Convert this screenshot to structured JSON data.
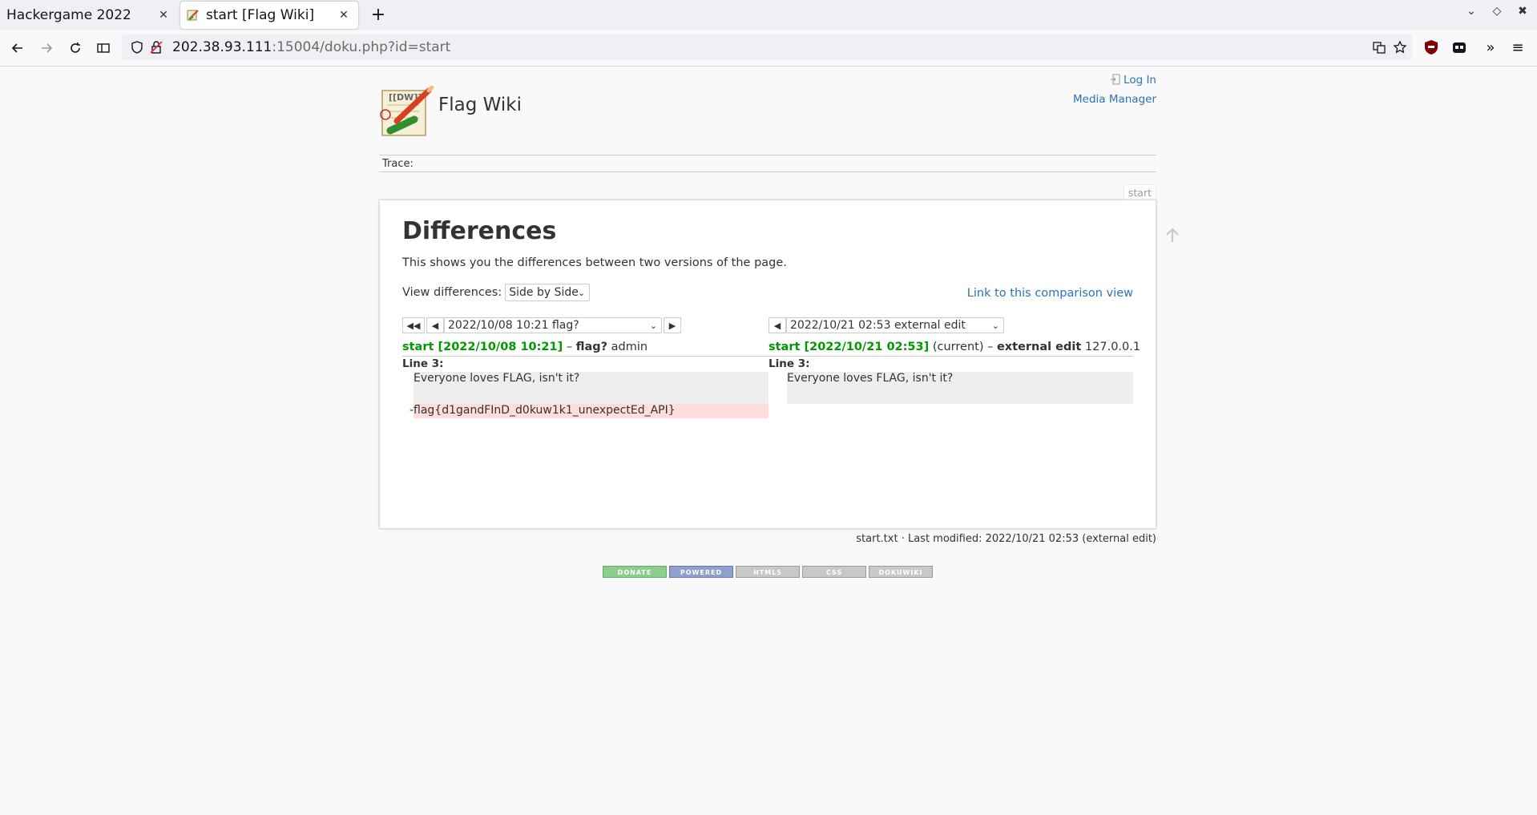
{
  "browser": {
    "tabs": [
      {
        "title": "Hackergame 2022"
      },
      {
        "title": "start [Flag Wiki]"
      }
    ],
    "url": {
      "host": "202.38.93.111",
      "rest": ":15004/doku.php?id=start"
    }
  },
  "wiki": {
    "title": "Flag Wiki",
    "usertools": {
      "login": "Log In",
      "media_manager": "Media Manager"
    },
    "trace_label": "Trace:",
    "page_id": "start",
    "heading": "Differences",
    "intro": "This shows you the differences between two versions of the page.",
    "view_diff_label": "View differences:",
    "view_diff_value": "Side by Side",
    "comparison_link": "Link to this comparison view",
    "left": {
      "revision_select": "2022/10/08 10:21 flag?",
      "link": "start [2022/10/08 10:21]",
      "summary_sep": " – ",
      "summary": "flag?",
      "user": "admin",
      "line_label": "Line 3:",
      "context_line": "Everyone loves FLAG, isn't it?",
      "deleted_marker": "-",
      "deleted_line": "flag{d1gandFInD_d0kuw1k1_unexpectEd_API}"
    },
    "right": {
      "revision_select": "2022/10/21 02:53 external edit",
      "link": "start [2022/10/21 02:53]",
      "current": "(current)",
      "summary_sep": " – ",
      "summary": "external edit",
      "user": "127.0.0.1",
      "line_label": "Line 3:",
      "context_line": "Everyone loves FLAG, isn't it?"
    },
    "footer_info": "start.txt · Last modified: 2022/10/21 02:53 (external edit)",
    "badges": [
      "DONATE",
      "POWERED",
      "HTML5",
      "CSS",
      "DOKUWIKI"
    ]
  },
  "colors": {
    "link": "#2b73b7",
    "revision_link": "#009900",
    "deleted_bg": "#ffdddd",
    "context_bg": "#eeeeee"
  }
}
